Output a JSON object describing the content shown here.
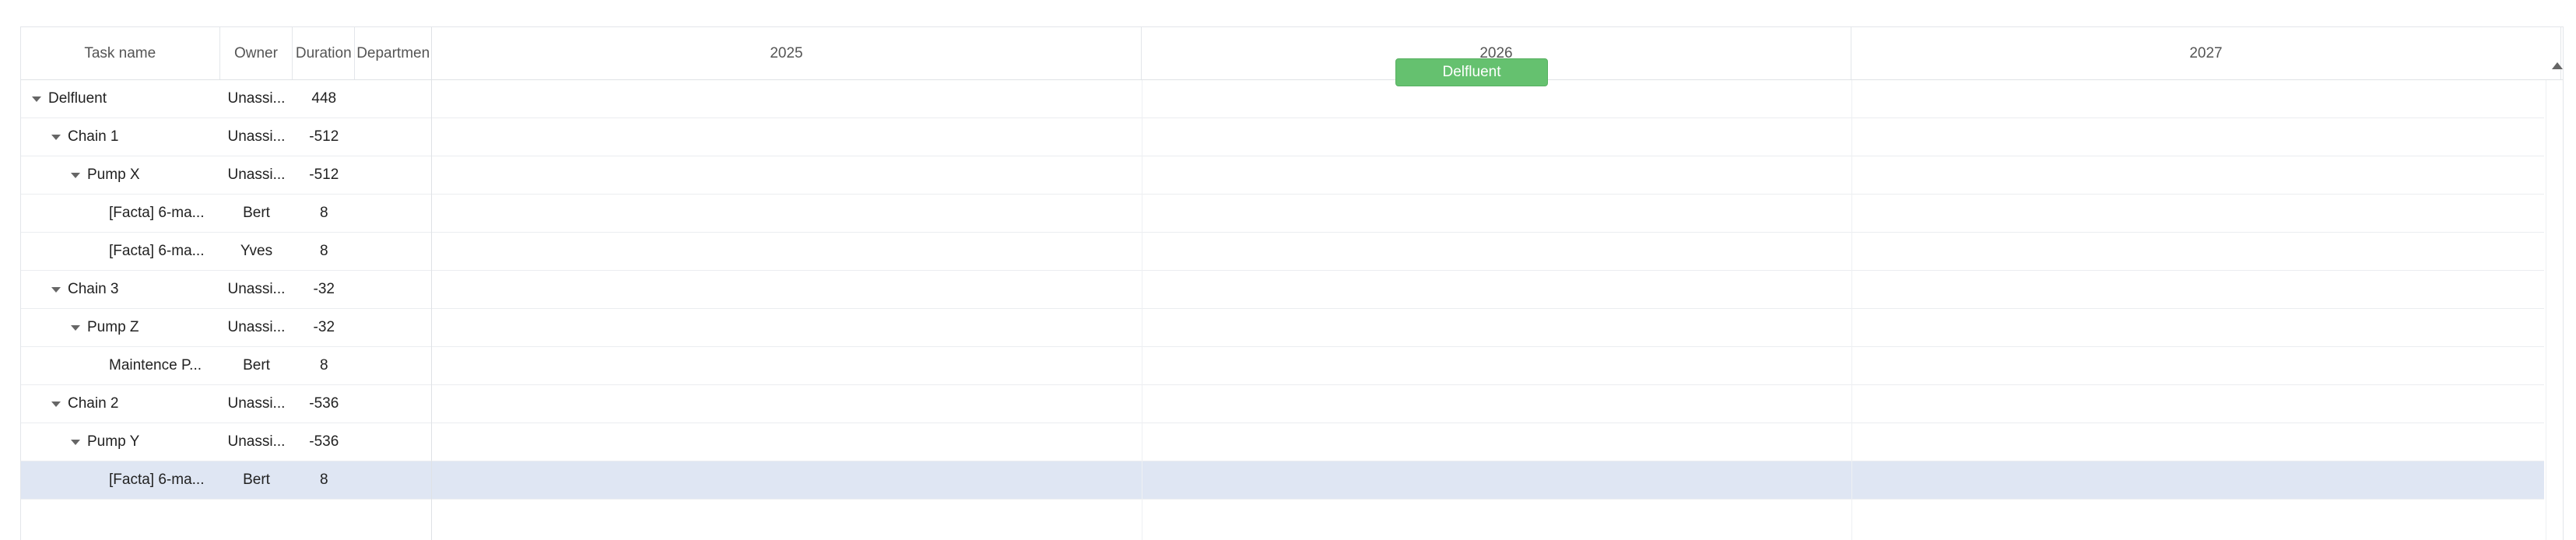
{
  "grid": {
    "columns": {
      "task": "Task name",
      "owner": "Owner",
      "duration": "Duration",
      "department": "Departmen"
    },
    "rows": [
      {
        "task": "Delfluent",
        "owner": "Unassi...",
        "duration": "448",
        "level": 0,
        "expandable": true
      },
      {
        "task": "Chain 1",
        "owner": "Unassi...",
        "duration": "-512",
        "level": 1,
        "expandable": true
      },
      {
        "task": "Pump X",
        "owner": "Unassi...",
        "duration": "-512",
        "level": 2,
        "expandable": true
      },
      {
        "task": "[Facta] 6-ma...",
        "owner": "Bert",
        "duration": "8",
        "level": 3,
        "expandable": false
      },
      {
        "task": "[Facta] 6-ma...",
        "owner": "Yves",
        "duration": "8",
        "level": 3,
        "expandable": false
      },
      {
        "task": "Chain 3",
        "owner": "Unassi...",
        "duration": "-32",
        "level": 1,
        "expandable": true
      },
      {
        "task": "Pump Z",
        "owner": "Unassi...",
        "duration": "-32",
        "level": 2,
        "expandable": true
      },
      {
        "task": "Maintence P...",
        "owner": "Bert",
        "duration": "8",
        "level": 3,
        "expandable": false
      },
      {
        "task": "Chain 2",
        "owner": "Unassi...",
        "duration": "-536",
        "level": 1,
        "expandable": true
      },
      {
        "task": "Pump Y",
        "owner": "Unassi...",
        "duration": "-536",
        "level": 2,
        "expandable": true
      },
      {
        "task": "[Facta] 6-ma...",
        "owner": "Bert",
        "duration": "8",
        "level": 3,
        "expandable": false,
        "selected": true
      }
    ]
  },
  "timeline": {
    "years": [
      "2025",
      "2026",
      "2027"
    ],
    "bar_label": "Delfluent",
    "bar_color": "#65c16f",
    "selection_color": "#dfe6f3"
  },
  "icons": {
    "tree_toggle": "caret-down-icon",
    "scroll": "scroll-up-arrow-icon"
  }
}
